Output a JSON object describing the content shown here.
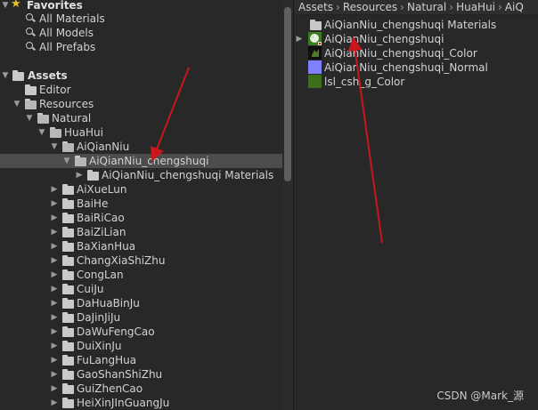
{
  "tree": {
    "favorites": {
      "label": "Favorites",
      "items": [
        "All Materials",
        "All Models",
        "All Prefabs"
      ]
    },
    "assets": {
      "label": "Assets",
      "editor": "Editor",
      "resources": "Resources",
      "natural": "Natural",
      "huahui": "HuaHui",
      "aiqianniu": "AiQianNiu",
      "aiqianniu_chengshuqi": "AiQianNiu_chengshuqi",
      "materials": "AiQianNiu_chengshuqi Materials",
      "plants": [
        "AiXueLun",
        "BaiHe",
        "BaiRiCao",
        "BaiZiLian",
        "BaXianHua",
        "ChangXiaShiZhu",
        "CongLan",
        "CuiJu",
        "DaHuaBinJu",
        "DaJinJiJu",
        "DaWuFengCao",
        "DuiXinJu",
        "FuLangHua",
        "GaoShanShiZhu",
        "GuiZhenCao",
        "HeiXinJInGuangJu"
      ]
    }
  },
  "breadcrumb": [
    "Assets",
    "Resources",
    "Natural",
    "HuaHui",
    "AiQ"
  ],
  "content": {
    "items": [
      {
        "label": "AiQianNiu_chengshuqi Materials",
        "icon": "folder-icon"
      },
      {
        "label": "AiQianNiu_chengshuqi",
        "icon": "model-prefab-icon"
      },
      {
        "label": "AiQianNiu_chengshuqi_Color",
        "icon": "texture-thumbnail-icon"
      },
      {
        "label": "AiQianNiu_chengshuqi_Normal",
        "icon": "normal-map-thumbnail-icon"
      },
      {
        "label": "lsl_csh_g_Color",
        "icon": "texture-thumbnail-icon"
      }
    ]
  },
  "watermark": "CSDN @Mark_源",
  "colors": {
    "panel": "#282828",
    "selection": "#4d4d4d",
    "annotation_arrow": "#c8161d",
    "favorites_star": "#f0c020",
    "normal_map": "#8080ff",
    "grass_texture": "#3c6e1e"
  }
}
